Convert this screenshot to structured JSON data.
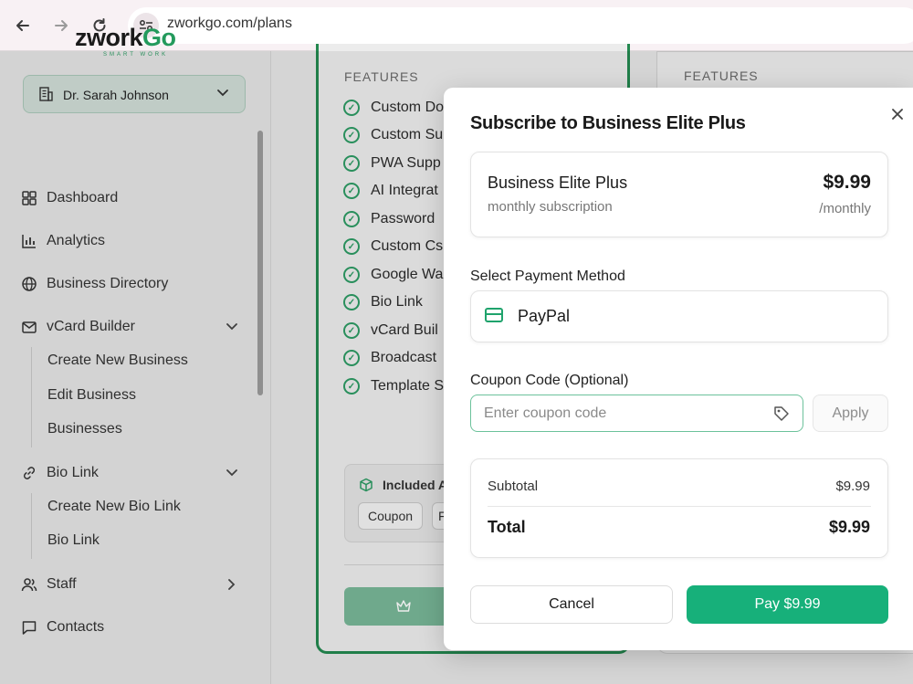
{
  "browser": {
    "url": "zworkgo.com/plans"
  },
  "sidebar": {
    "logo": {
      "brand_a": "zwork",
      "brand_b": "Go",
      "tagline": "SMART WORK"
    },
    "user_name": "Dr. Sarah Johnson",
    "items": [
      {
        "label": "Dashboard",
        "icon": "grid-icon"
      },
      {
        "label": "Analytics",
        "icon": "bar-chart-icon"
      },
      {
        "label": "Business Directory",
        "icon": "globe-icon"
      },
      {
        "label": "vCard Builder",
        "icon": "mail-icon",
        "children": [
          "Create New Business",
          "Edit Business",
          "Businesses"
        ]
      },
      {
        "label": "Bio Link",
        "icon": "link-icon",
        "children": [
          "Create New Bio Link",
          "Bio Link"
        ]
      },
      {
        "label": "Staff",
        "icon": "users-icon"
      },
      {
        "label": "Contacts",
        "icon": "message-icon"
      }
    ]
  },
  "background_cards": {
    "features_title": "FEATURES",
    "features_title_second": "FEATURES",
    "features": [
      "Custom Do",
      "Custom Su",
      "PWA Supp",
      "AI Integrat",
      "Password",
      "Custom Cs",
      "Google Wa",
      "Bio Link",
      "vCard Buil",
      "Broadcast",
      "Template S"
    ],
    "addons_title": "Included A",
    "chips": [
      "Coupon",
      "F"
    ]
  },
  "modal": {
    "title": "Subscribe to Business Elite Plus",
    "plan": {
      "name": "Business Elite Plus",
      "subtitle": "monthly subscription",
      "price": "$9.99",
      "period": "/monthly"
    },
    "payment_label": "Select Payment Method",
    "payment_method": "PayPal",
    "coupon_label": "Coupon Code (Optional)",
    "coupon_placeholder": "Enter coupon code",
    "apply_label": "Apply",
    "summary": {
      "subtotal_label": "Subtotal",
      "subtotal_value": "$9.99",
      "total_label": "Total",
      "total_value": "$9.99"
    },
    "cancel_label": "Cancel",
    "pay_label": "Pay $9.99"
  },
  "colors": {
    "accent": "#17b07a",
    "brand_green": "#239a5c",
    "card_border": "#23884f"
  }
}
